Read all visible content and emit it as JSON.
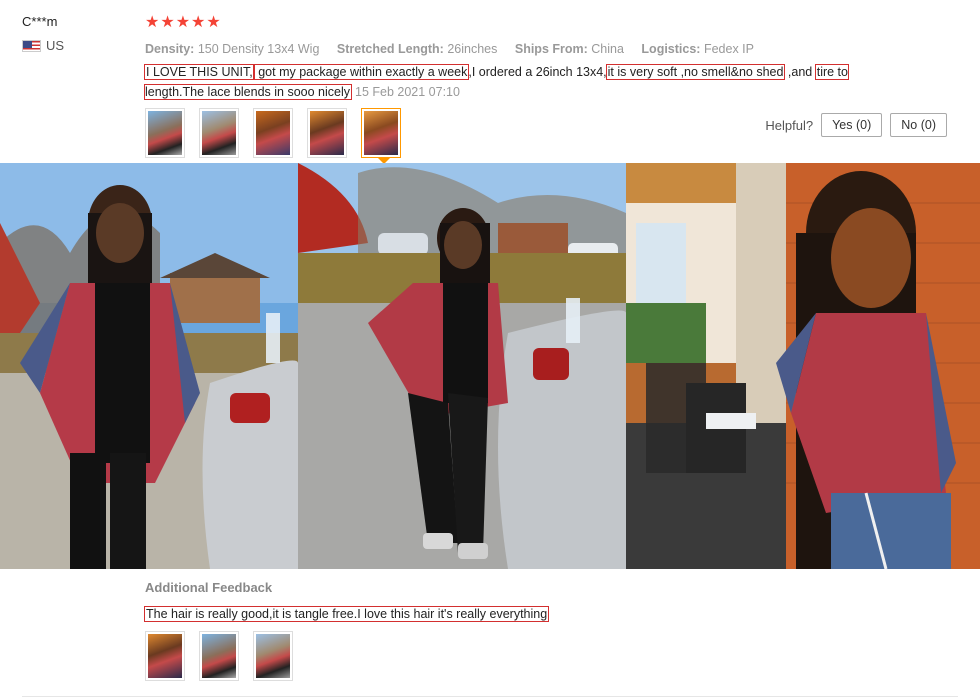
{
  "reviewer": {
    "name": "C***m",
    "country": "US"
  },
  "rating": {
    "stars": "★★★★★"
  },
  "attributes": [
    {
      "key": "Density:",
      "value": "150 Density 13x4 Wig"
    },
    {
      "key": "Stretched Length:",
      "value": "26inches"
    },
    {
      "key": "Ships From:",
      "value": "China"
    },
    {
      "key": "Logistics:",
      "value": "Fedex IP"
    }
  ],
  "review": {
    "part1": "I LOVE THIS UNIT,",
    "part2": " got my package within exactly a week",
    "part3": ",I ordered a 26inch 13x4,",
    "part4": "it is very soft ,no smell&no shed",
    "part5": " ,and ",
    "part6": "tire to length.The lace blends in sooo nicely",
    "date": "15 Feb 2021 07:10"
  },
  "helpful": {
    "label": "Helpful?",
    "yes": "Yes (0)",
    "no": "No (0)"
  },
  "additional": {
    "title": "Additional Feedback",
    "text": "The hair is really good,it is tangle free.I love this hair it's really everything"
  },
  "colors": {
    "star": "#f44336",
    "highlight": "#d32f2f",
    "active_thumb": "#ff9800"
  }
}
